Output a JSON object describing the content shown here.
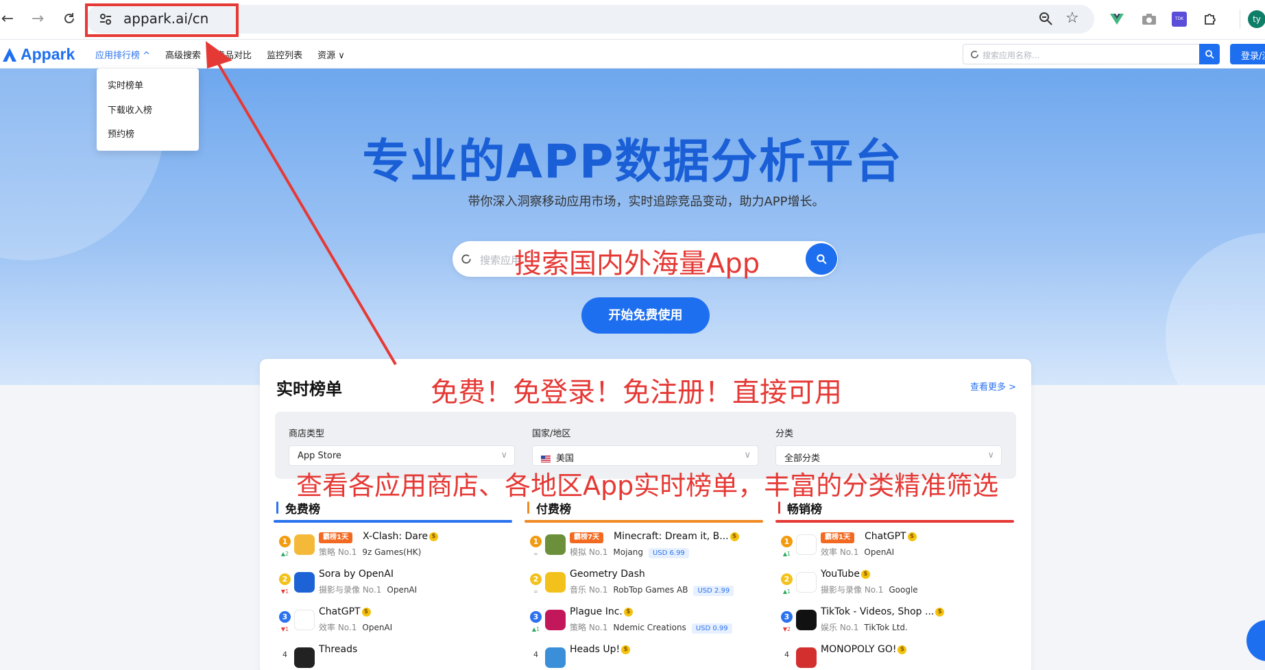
{
  "browser": {
    "url": "appark.ai/cn",
    "profile_initials": "ty",
    "tdk_label": "TDK"
  },
  "site": {
    "logo_text": "Appark",
    "menu": [
      {
        "label": "应用排行榜 ^",
        "active": true
      },
      {
        "label": "高级搜索",
        "active": false
      },
      {
        "label": "竞品对比",
        "active": false
      },
      {
        "label": "监控列表",
        "active": false
      },
      {
        "label": "资源 ∨",
        "active": false
      }
    ],
    "search_placeholder": "搜索应用名称...",
    "login_label": "登录/注册"
  },
  "dropdown": {
    "items": [
      "实时榜单",
      "下载收入榜",
      "预约榜"
    ]
  },
  "hero": {
    "title": "专业的APP数据分析平台",
    "subtitle": "带你深入洞察移动应用市场，实时追踪竞品变动，助力APP增长。",
    "search_placeholder": "搜索应用",
    "start_label": "开始免费使用"
  },
  "realtime": {
    "title": "实时榜单",
    "more": "查看更多 >",
    "filters": [
      {
        "label": "商店类型",
        "value": "App Store"
      },
      {
        "label": "国家/地区",
        "value": "美国"
      },
      {
        "label": "分类",
        "value": "全部分类"
      }
    ],
    "columns": [
      {
        "title": "免费榜",
        "color": "#2a72ee",
        "rows": [
          {
            "rank": "1",
            "trend": "▲2",
            "trend_type": "up",
            "badge": "霸榜1天",
            "name": "X-Clash: Dare",
            "coin": true,
            "meta": "策略 No.1",
            "dev": "9z Games(HK)",
            "price": ""
          },
          {
            "rank": "2",
            "trend": "▼1",
            "trend_type": "down",
            "badge": "",
            "name": "Sora by OpenAI",
            "coin": false,
            "meta": "摄影与录像 No.1",
            "dev": "OpenAI",
            "price": ""
          },
          {
            "rank": "3",
            "trend": "▼1",
            "trend_type": "down",
            "badge": "",
            "name": "ChatGPT",
            "coin": true,
            "meta": "效率 No.1",
            "dev": "OpenAI",
            "price": ""
          },
          {
            "rank": "4",
            "trend": "",
            "trend_type": "eq",
            "badge": "",
            "name": "Threads",
            "coin": false,
            "meta": "",
            "dev": "",
            "price": ""
          }
        ]
      },
      {
        "title": "付费榜",
        "color": "#f08a24",
        "rows": [
          {
            "rank": "1",
            "trend": "=",
            "trend_type": "eq",
            "badge": "霸榜7天",
            "name": "Minecraft: Dream it, B...",
            "coin": true,
            "meta": "模拟 No.1",
            "dev": "Mojang",
            "price": "USD 6.99"
          },
          {
            "rank": "2",
            "trend": "=",
            "trend_type": "eq",
            "badge": "",
            "name": "Geometry Dash",
            "coin": false,
            "meta": "音乐 No.1",
            "dev": "RobTop Games AB",
            "price": "USD 2.99"
          },
          {
            "rank": "3",
            "trend": "▲1",
            "trend_type": "up",
            "badge": "",
            "name": "Plague Inc.",
            "coin": true,
            "meta": "策略 No.1",
            "dev": "Ndemic Creations",
            "price": "USD 0.99"
          },
          {
            "rank": "4",
            "trend": "",
            "trend_type": "eq",
            "badge": "",
            "name": "Heads Up!",
            "coin": true,
            "meta": "",
            "dev": "",
            "price": ""
          }
        ]
      },
      {
        "title": "畅销榜",
        "color": "#e53935",
        "rows": [
          {
            "rank": "1",
            "trend": "▲1",
            "trend_type": "up",
            "badge": "霸榜1天",
            "name": "ChatGPT",
            "coin": true,
            "meta": "效率 No.1",
            "dev": "OpenAI",
            "price": ""
          },
          {
            "rank": "2",
            "trend": "▲1",
            "trend_type": "up",
            "badge": "",
            "name": "YouTube",
            "coin": true,
            "meta": "摄影与录像 No.1",
            "dev": "Google",
            "price": ""
          },
          {
            "rank": "3",
            "trend": "▼2",
            "trend_type": "down",
            "badge": "",
            "name": "TikTok - Videos, Shop ...",
            "coin": true,
            "meta": "娱乐 No.1",
            "dev": "TikTok Ltd.",
            "price": ""
          },
          {
            "rank": "4",
            "trend": "",
            "trend_type": "eq",
            "badge": "",
            "name": "MONOPOLY GO!",
            "coin": true,
            "meta": "",
            "dev": "",
            "price": ""
          }
        ]
      }
    ]
  },
  "annotations": {
    "search": "搜索国内外海量App",
    "free": "免费！免登录！免注册！直接可用",
    "filter": "查看各应用商店、各地区App实时榜单，丰富的分类精准筛选"
  },
  "colors": {
    "accent": "#1e6ff0",
    "annotation": "#e53935",
    "rank_gold": "#f29b10",
    "rank_silver": "#f3c11b",
    "rank_blue": "#2a72ee"
  }
}
